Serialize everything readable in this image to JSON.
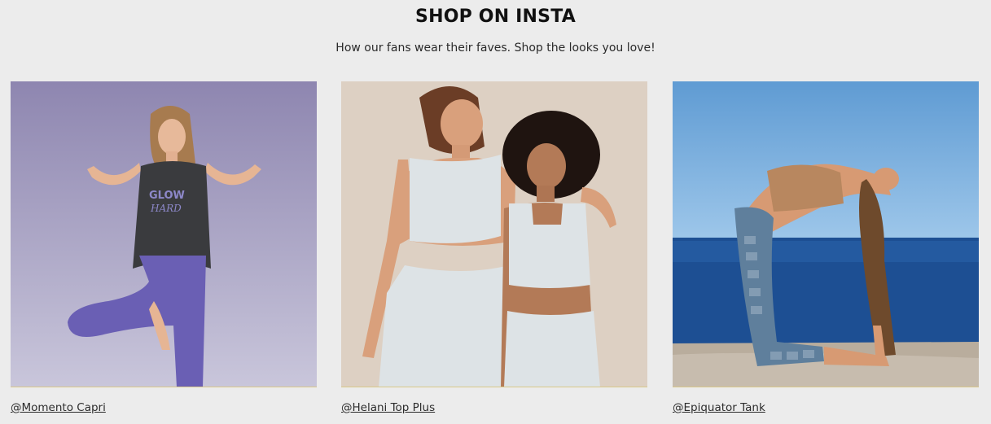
{
  "section": {
    "title": "SHOP ON INSTA",
    "subtitle": "How our fans wear their faves. Shop the looks you love!"
  },
  "posts": [
    {
      "caption": "@Momento Capri",
      "image": "yoga-pose-woman-glow-hard-tank",
      "top_print": "GLOW HARD",
      "colors": {
        "bg_top": "#8e86b0",
        "bg_bottom": "#c6c3d9",
        "legging": "#6a5fb4",
        "top": "#3a3b3e"
      }
    },
    {
      "caption": "@Helani Top Plus",
      "image": "two-women-light-grey-activewear",
      "colors": {
        "bg": "#ddd0c3",
        "outfit": "#dde3e6"
      }
    },
    {
      "caption": "@Epiquator Tank",
      "image": "woman-backbend-by-sea",
      "colors": {
        "sky": "#6aa4d6",
        "sea": "#1d4f93",
        "rock": "#b9ad9d",
        "legging": "#5f7f9c"
      }
    }
  ]
}
